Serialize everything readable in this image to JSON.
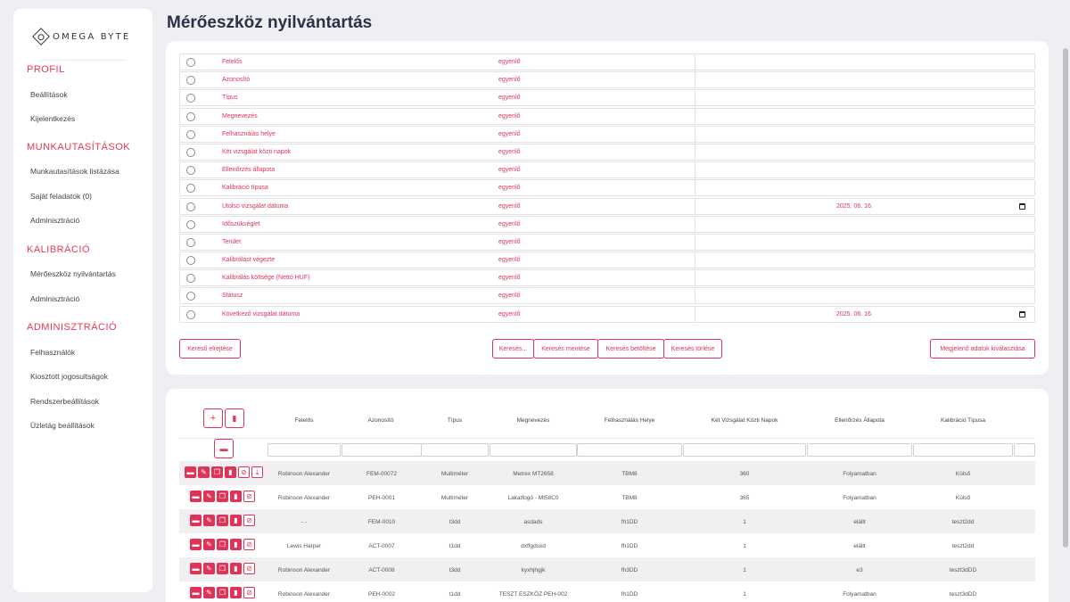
{
  "logo_text": "OMEGA BYTE",
  "sidebar": [
    {
      "section": "PROFIL",
      "items": [
        "Beállítások",
        "Kijelentkezés"
      ]
    },
    {
      "section": "MUNKAUTASÍTÁSOK",
      "items": [
        "Munkautasítások listázása",
        "Saját feladatok (0)",
        "Adminisztráció"
      ]
    },
    {
      "section": "KALIBRÁCIÓ",
      "items": [
        "Mérőeszköz nyilvántartás",
        "Adminisztráció"
      ]
    },
    {
      "section": "ADMINISZTRÁCIÓ",
      "items": [
        "Felhasználók",
        "Kiosztott jogosultságok",
        "Rendszerbeállítások",
        "Üzletág beállítások"
      ]
    }
  ],
  "page_title": "Mérőeszköz nyilvántartás",
  "filters": [
    {
      "label": "Felelős",
      "op": "egyenlő",
      "value": ""
    },
    {
      "label": "Azonosító",
      "op": "egyenlő",
      "value": ""
    },
    {
      "label": "Típus",
      "op": "egyenlő",
      "value": ""
    },
    {
      "label": "Megnevezés",
      "op": "egyenlő",
      "value": ""
    },
    {
      "label": "Felhasználás helye",
      "op": "egyenlő",
      "value": ""
    },
    {
      "label": "Két vizsgálat közti napok",
      "op": "egyenlő",
      "value": ""
    },
    {
      "label": "Ellenőrzés állapota",
      "op": "egyenlő",
      "value": ""
    },
    {
      "label": "Kalibráció típusa",
      "op": "egyenlő",
      "value": ""
    },
    {
      "label": "Utolsó vizsgálat dátuma",
      "op": "egyenlő",
      "value": "2025. 06. 16."
    },
    {
      "label": "Időszükséglet",
      "op": "egyenlő",
      "value": ""
    },
    {
      "label": "Terület",
      "op": "egyenlő",
      "value": ""
    },
    {
      "label": "Kalibrálást végezte",
      "op": "egyenlő",
      "value": ""
    },
    {
      "label": "Kalibrálás költsége (Nettó HUF)",
      "op": "egyenlő",
      "value": ""
    },
    {
      "label": "Státusz",
      "op": "egyenlő",
      "value": ""
    },
    {
      "label": "Következő vizsgálat dátuma",
      "op": "egyenlő",
      "value": "2025. 06. 16."
    }
  ],
  "buttons": {
    "hide_search": "Kereső elrejtése",
    "search": "Keresés...",
    "save_search": "Keresés mentése",
    "load_search": "Keresés betöltése",
    "delete_search": "Keresés törlése",
    "select_columns": "Megjelenő adatok kiválasztása"
  },
  "icons": {
    "add": "plus-icon",
    "export": "file-icon",
    "delete": "trash-icon",
    "row_actions": [
      "folder-icon",
      "edit-icon",
      "copy-icon",
      "document-icon",
      "block-icon",
      "download-icon"
    ]
  },
  "table": {
    "columns": [
      "Felelős",
      "Azonosító",
      "Típus",
      "Megnevezés",
      "Felhasználás Helye",
      "Két Vizsgálat Közti Napok",
      "Ellenőrzés Állapota",
      "Kalibráció Típusa"
    ],
    "rows": [
      [
        "Robinson Alexander",
        "FEM-00072",
        "Multiméter",
        "Metrex MT2658",
        "TBM8",
        "360",
        "Folyamatban",
        "Külső"
      ],
      [
        "Robinson Alexander",
        "PEH-0001",
        "Multiméter",
        "Lakatfogó - Mt58C0",
        "TBM8",
        "365",
        "Folyamatban",
        "Külső"
      ],
      [
        "- -",
        "FEM-0010",
        "t3dd",
        "asdads",
        "fh1DD",
        "1",
        "elállt",
        "teszt2dd"
      ],
      [
        "Lewis Harper",
        "ACT-0007",
        "t1dd",
        "dxffgdsxd",
        "fh1DD",
        "1",
        "elállt",
        "teszt2dd"
      ],
      [
        "Robinson Alexander",
        "ACT-0008",
        "t3dd",
        "kyxhjhgjk",
        "fh3DD",
        "1",
        "e3",
        "teszt3dDD"
      ],
      [
        "Robinson Alexander",
        "PEH-0002",
        "t1dd",
        "TESZT ESZKÖZ PEH-002",
        "fh1DD",
        "1",
        "Folyamatban",
        "teszt3dDD"
      ]
    ]
  }
}
